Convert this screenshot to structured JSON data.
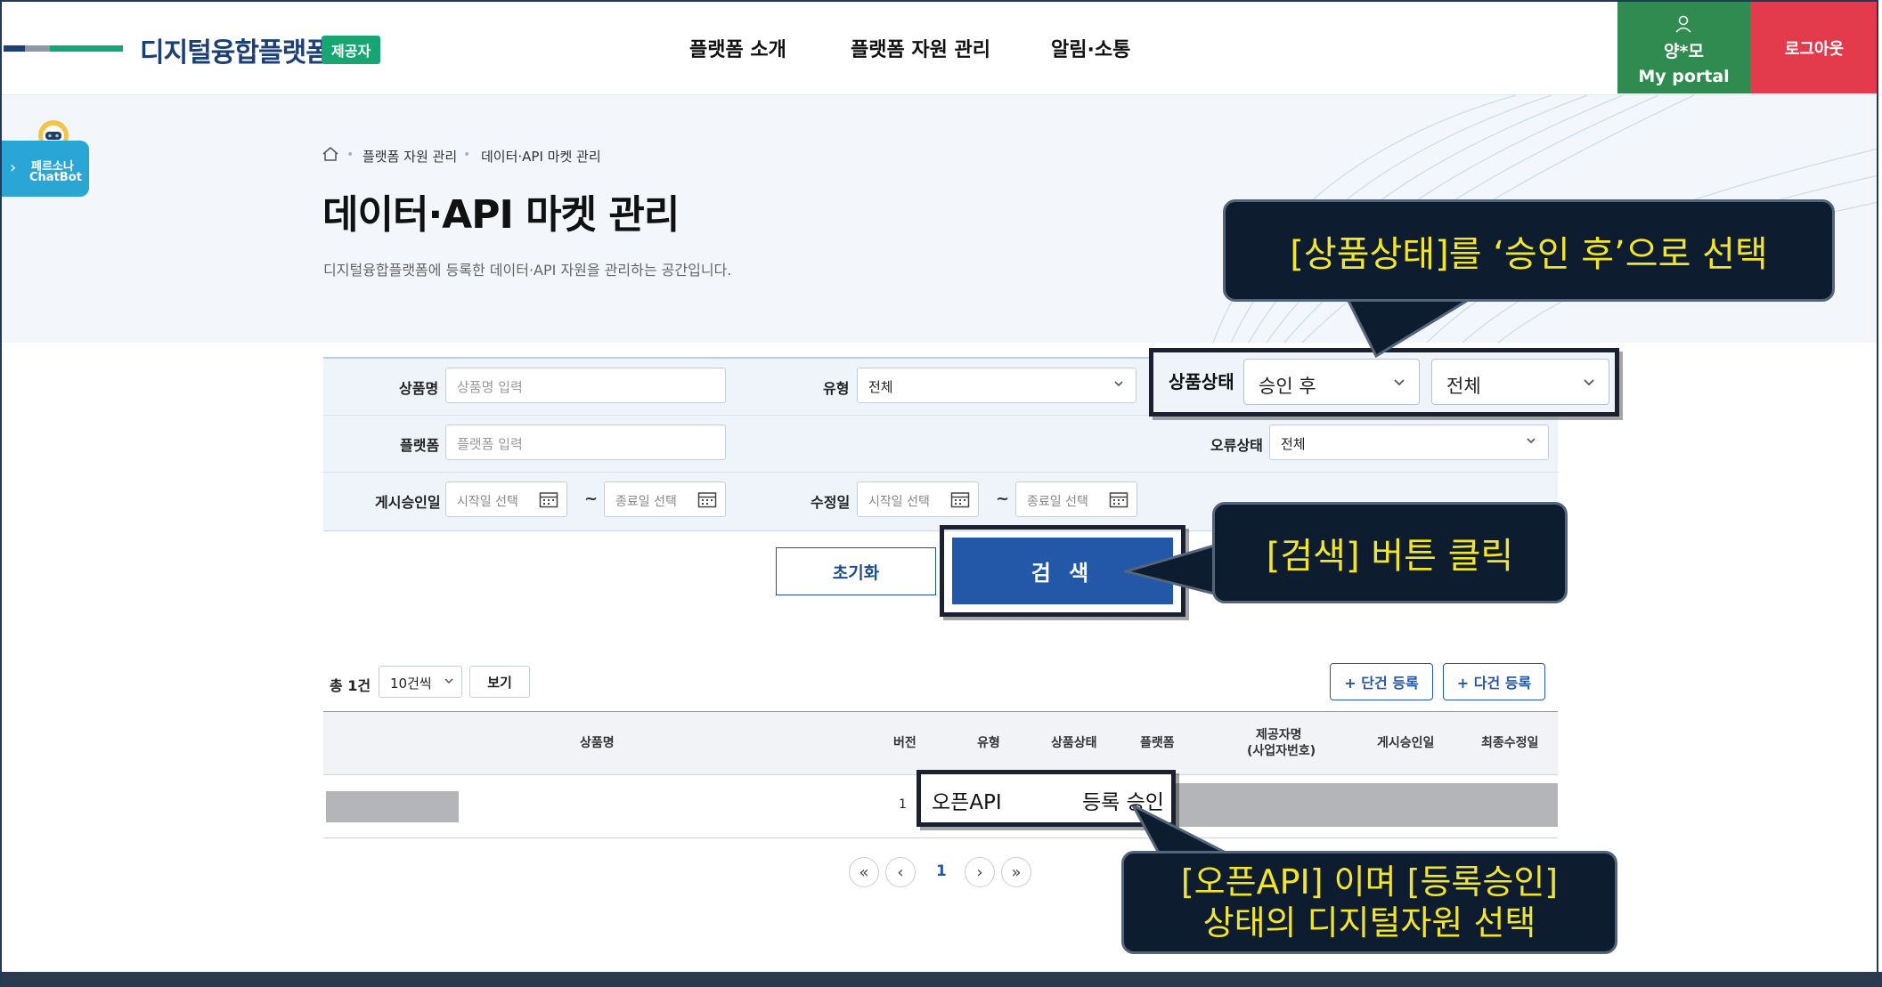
{
  "header": {
    "logo_text": "디지털융합플랫폼",
    "badge": "제공자",
    "nav": [
      "플랫폼 소개",
      "플랫폼 자원 관리",
      "알림·소통"
    ],
    "user_name": "양*모",
    "portal_label": "My portal",
    "logout_label": "로그아웃"
  },
  "chatbot": {
    "line1": "페르소나",
    "line2": "ChatBot"
  },
  "breadcrumb": [
    "플랫폼 자원 관리",
    "데이터·API 마켓 관리"
  ],
  "page": {
    "title": "데이터·API 마켓 관리",
    "description": "디지털융합플랫폼에 등록한 데이터·API 자원을 관리하는 공간입니다."
  },
  "search": {
    "product_name_label": "상품명",
    "product_name_placeholder": "상품명 입력",
    "type_label": "유형",
    "type_value": "전체",
    "status_label": "상품상태",
    "status_value_1": "승인 후",
    "status_value_2": "전체",
    "platform_label": "플랫폼",
    "platform_placeholder": "플랫폼 입력",
    "error_label": "오류상태",
    "error_value": "전체",
    "approval_date_label": "게시승인일",
    "modified_date_label": "수정일",
    "start_placeholder": "시작일 선택",
    "end_placeholder": "종료일 선택",
    "tilde": "~",
    "reset_label": "초기화",
    "search_label": "검 색"
  },
  "list": {
    "total": "총 1건",
    "page_size": "10건씩",
    "view_label": "보기",
    "register_single": "+ 단건 등록",
    "register_multi": "+ 다건 등록",
    "columns": [
      "상품명",
      "버전",
      "유형",
      "상품상태",
      "플랫폼",
      "제공자명",
      "(사업자번호)",
      "게시승인일",
      "최종수정일"
    ],
    "row": {
      "version": "1",
      "type": "오픈API",
      "status": "등록 승인"
    }
  },
  "pagination": {
    "first": "«",
    "prev": "‹",
    "current": "1",
    "next": "›",
    "last": "»"
  },
  "annotations": {
    "callout_status": "[상품상태]를 ‘승인 후’으로 선택",
    "callout_search": "[검색] 버튼 클릭",
    "callout_row_line1": "[오픈API] 이며 [등록승인]",
    "callout_row_line2": "상태의 디지털자원 선택"
  },
  "colors": {
    "brand_navy": "#1c3f75",
    "badge_green": "#17a673",
    "portal_green": "#2f8b4f",
    "logout_red": "#e33a4c",
    "primary_blue": "#2358a8",
    "callout_bg": "#0e1c2f",
    "callout_text": "#f2e52a"
  }
}
